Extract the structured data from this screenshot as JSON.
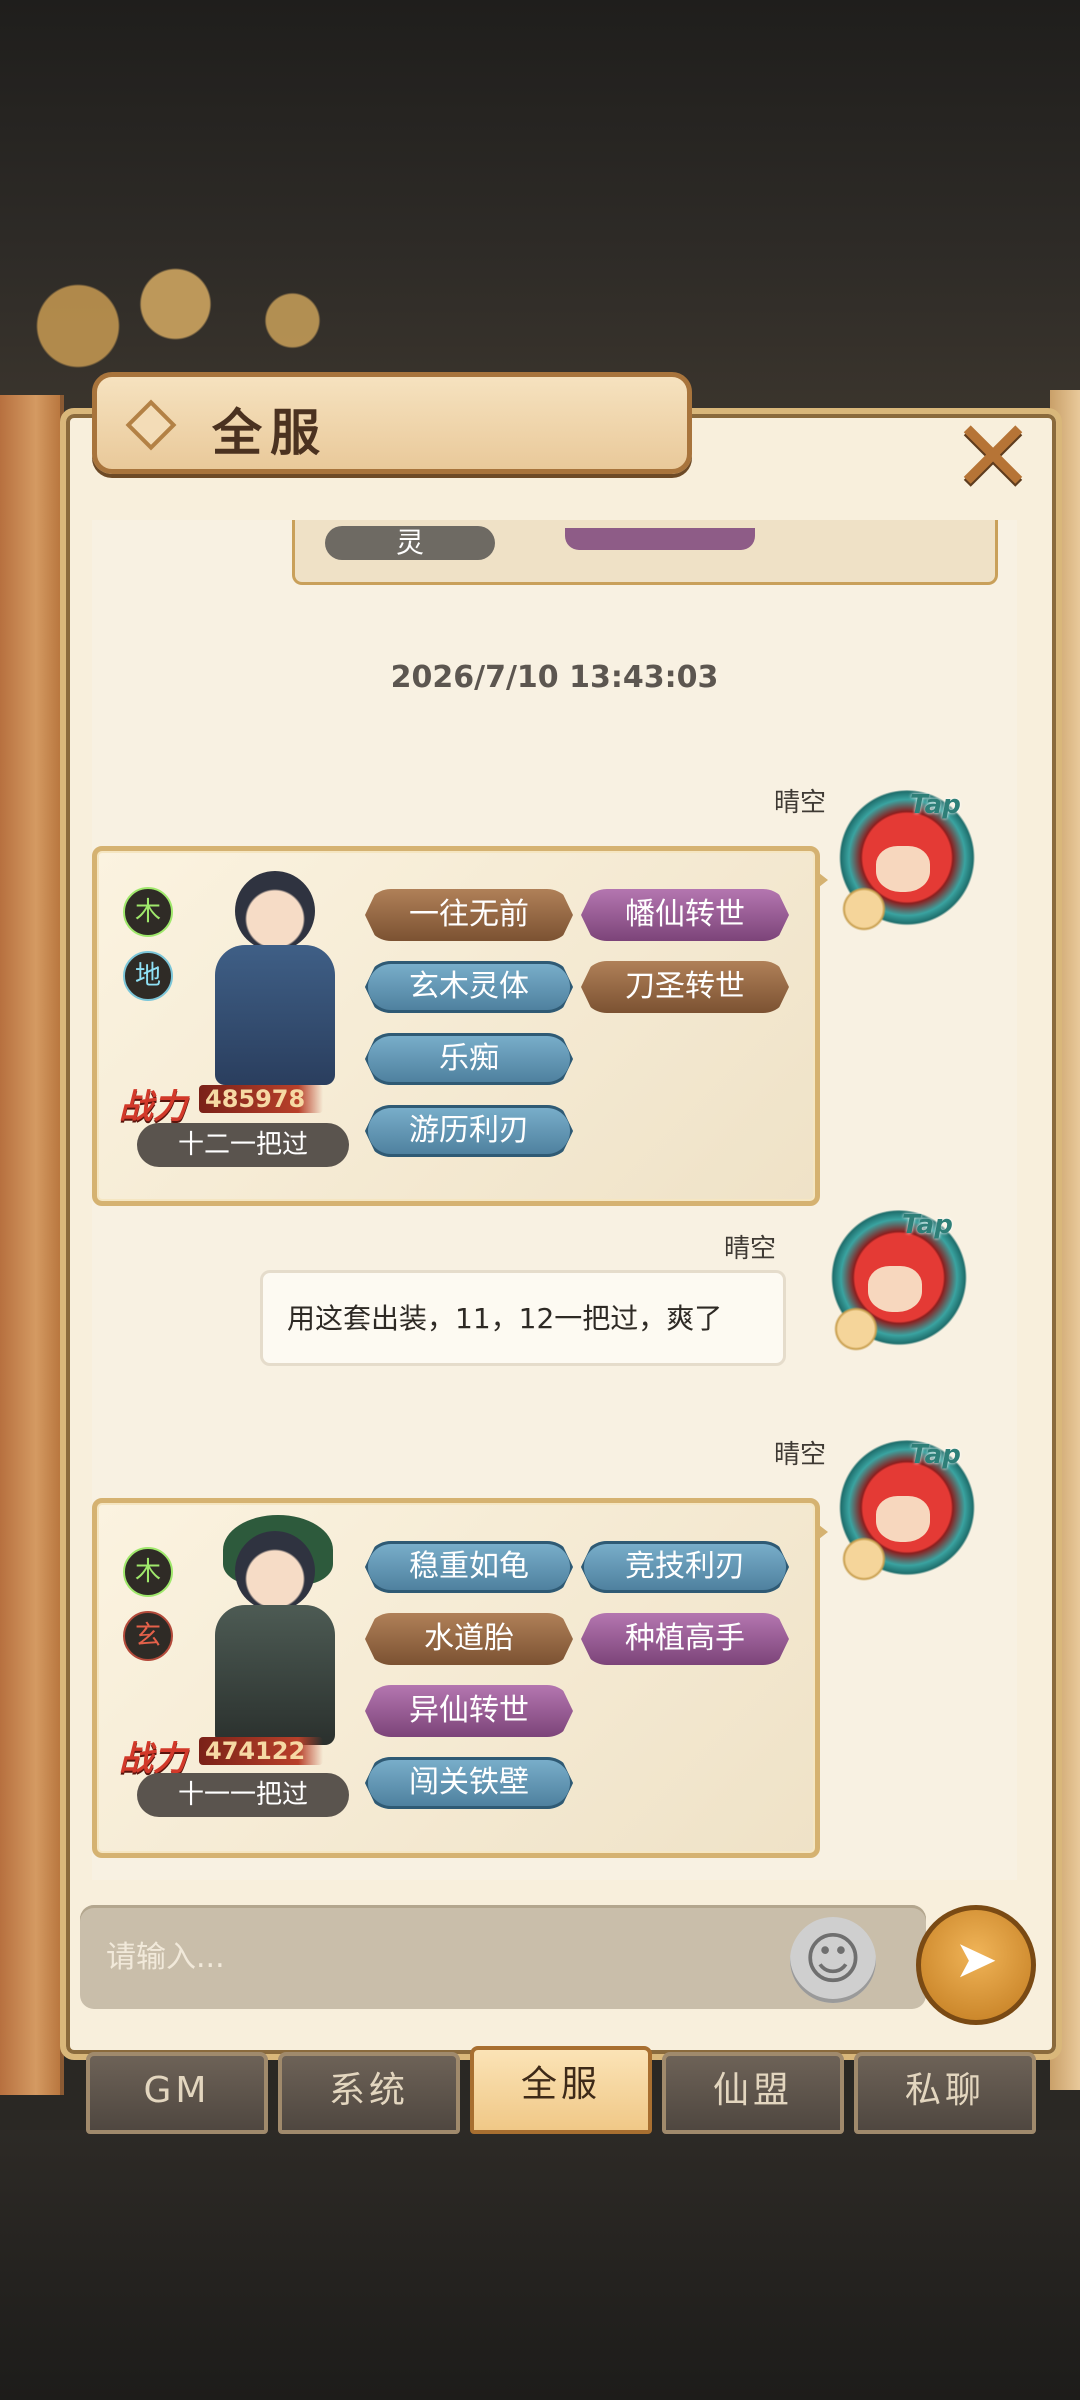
{
  "header": {
    "title": "全服",
    "close_label": "✕"
  },
  "chat": {
    "previous_card": {
      "chip_text": "灵"
    },
    "timestamp": "2026/7/10 13:43:03",
    "messages": [
      {
        "sender": "晴空",
        "avatar_badge": "Tap",
        "card": {
          "elements": [
            "木",
            "地"
          ],
          "power_label": "战力",
          "power_value": "485978",
          "level_tag": "十二一把过",
          "chips": [
            {
              "label": "一往无前",
              "color": "brown"
            },
            {
              "label": "幡仙转世",
              "color": "purple"
            },
            {
              "label": "玄木灵体",
              "color": "blue"
            },
            {
              "label": "刀圣转世",
              "color": "brown"
            },
            {
              "label": "乐痴",
              "color": "blue"
            },
            {
              "label": "游历利刃",
              "color": "blue"
            }
          ]
        }
      },
      {
        "sender": "晴空",
        "avatar_badge": "Tap",
        "text": "用这套出装，11，12一把过，爽了"
      },
      {
        "sender": "晴空",
        "avatar_badge": "Tap",
        "card": {
          "elements": [
            "木",
            "玄"
          ],
          "power_label": "战力",
          "power_value": "474122",
          "level_tag": "十一一把过",
          "chips": [
            {
              "label": "稳重如龟",
              "color": "blue"
            },
            {
              "label": "竞技利刃",
              "color": "blue"
            },
            {
              "label": "水道胎",
              "color": "brown"
            },
            {
              "label": "种植高手",
              "color": "purple"
            },
            {
              "label": "异仙转世",
              "color": "purple"
            },
            {
              "label": "闯关铁壁",
              "color": "blue"
            }
          ]
        }
      }
    ]
  },
  "input": {
    "placeholder": "请输入...",
    "emoji_icon": "☺",
    "send_icon": "➤"
  },
  "tabs": [
    {
      "label": "GM",
      "active": false
    },
    {
      "label": "系统",
      "active": false
    },
    {
      "label": "全服",
      "active": true
    },
    {
      "label": "仙盟",
      "active": false
    },
    {
      "label": "私聊",
      "active": false
    }
  ],
  "colors": {
    "panel": "#f8efdc",
    "frame": "#d9b77a",
    "active_tab": "#f0c887"
  }
}
